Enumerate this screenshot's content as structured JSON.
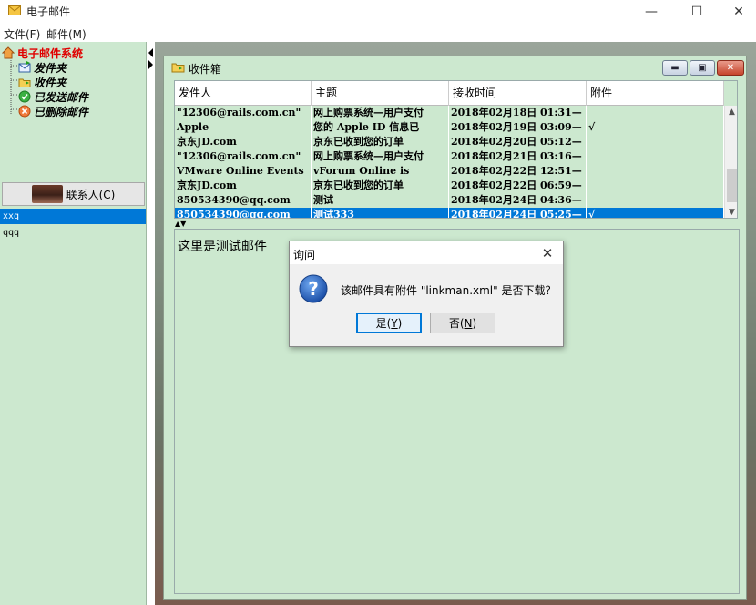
{
  "window": {
    "title": "电子邮件",
    "min_glyph": "—",
    "max_glyph": "☐",
    "close_glyph": "✕"
  },
  "menu": {
    "file": "文件(F)",
    "mail": "邮件(M)"
  },
  "tree": {
    "root": "电子邮件系统",
    "items": [
      {
        "label": "发件夹",
        "icon": "outbox-icon"
      },
      {
        "label": "收件夹",
        "icon": "inbox-folder-icon"
      },
      {
        "label": "已发送邮件",
        "icon": "sent-check-icon"
      },
      {
        "label": "已删除邮件",
        "icon": "deleted-x-icon"
      }
    ]
  },
  "contacts": {
    "button_label": "联系人(C)",
    "list": [
      "xxq",
      "qqq"
    ]
  },
  "inbox": {
    "title": "收件箱",
    "columns": [
      "发件人",
      "主题",
      "接收时间",
      "附件"
    ],
    "rows": [
      {
        "from": "\"12306@rails.com.cn\"",
        "subject": "网上购票系统—用户支付",
        "time": "2018年02月18日 01:31—",
        "attachment": ""
      },
      {
        "from": "Apple",
        "subject": "您的 Apple ID 信息已",
        "time": "2018年02月19日 03:09—",
        "attachment": "√"
      },
      {
        "from": "京东JD.com",
        "subject": "京东已收到您的订单",
        "time": "2018年02月20日 05:12—",
        "attachment": ""
      },
      {
        "from": "\"12306@rails.com.cn\"",
        "subject": "网上购票系统—用户支付",
        "time": "2018年02月21日 03:16—",
        "attachment": ""
      },
      {
        "from": "VMware Online Events",
        "subject": "vForum Online is",
        "time": "2018年02月22日 12:51—",
        "attachment": ""
      },
      {
        "from": "京东JD.com",
        "subject": "京东已收到您的订单",
        "time": "2018年02月22日 06:59—",
        "attachment": ""
      },
      {
        "from": "850534390@qq.com",
        "subject": "测试",
        "time": "2018年02月24日 04:36—",
        "attachment": ""
      },
      {
        "from": "850534390@qq.com",
        "subject": "测试333",
        "time": "2018年02月24日 05:25—",
        "attachment": "√"
      }
    ],
    "selected_row": 7,
    "body_text": "这里是测试邮件"
  },
  "dialog": {
    "title": "询问",
    "message": "该邮件具有附件 \"linkman.xml\" 是否下载？",
    "yes_label": "是",
    "yes_key": "(Y)",
    "no_label": "否",
    "no_key": "(N)"
  },
  "colors": {
    "pane_bg": "#cce8cf",
    "selection": "#0078d7",
    "root_red": "#e00000"
  }
}
